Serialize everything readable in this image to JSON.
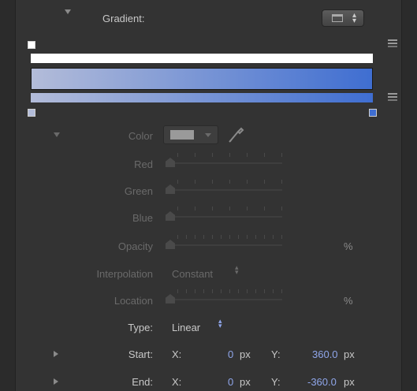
{
  "header": {
    "title": "Gradient:"
  },
  "gradient": {
    "start_color": "#b3bcd9",
    "end_color": "#3f6ed1",
    "opacity_bar_color": "#ffffff"
  },
  "color_row": {
    "label": "Color"
  },
  "channels": {
    "red": "Red",
    "green": "Green",
    "blue": "Blue",
    "opacity": "Opacity",
    "opacity_unit": "%"
  },
  "interpolation": {
    "label": "Interpolation",
    "value": "Constant"
  },
  "location": {
    "label": "Location",
    "unit": "%"
  },
  "type_row": {
    "label": "Type:",
    "value": "Linear"
  },
  "start_row": {
    "label": "Start:",
    "x_label": "X:",
    "x_value": "0",
    "x_unit": "px",
    "y_label": "Y:",
    "y_value": "360.0",
    "y_unit": "px"
  },
  "end_row": {
    "label": "End:",
    "x_label": "X:",
    "x_value": "0",
    "x_unit": "px",
    "y_label": "Y:",
    "y_value": "-360.0",
    "y_unit": "px"
  },
  "icons": {
    "disclosure_open": "triangle-down",
    "disclosure_closed": "triangle-right",
    "eyedropper": "eyedropper-icon",
    "preset_menu": "gradient-preset-icon"
  }
}
